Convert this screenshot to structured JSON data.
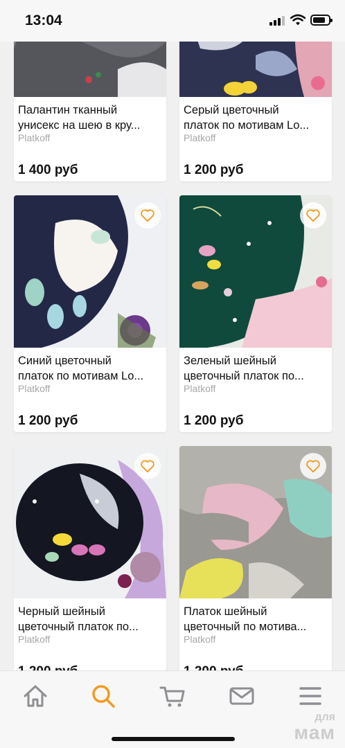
{
  "status_bar": {
    "time": "13:04"
  },
  "products": [
    {
      "title": "Палантин тканный\nунисекс  на шею в кру...",
      "shop": "Platkoff",
      "price": "1 400 руб"
    },
    {
      "title": "Серый   цветочный\nплаток  по мотивам Lo...",
      "shop": "Platkoff",
      "price": "1 200 руб"
    },
    {
      "title": "Синий  цветочный\nплаток  по мотивам Lo...",
      "shop": "Platkoff",
      "price": "1 200 руб"
    },
    {
      "title": "Зеленый шейный\nцветочный платок  по...",
      "shop": "Platkoff",
      "price": "1 200 руб"
    },
    {
      "title": "Черный шейный\nцветочный платок  по...",
      "shop": "Platkoff",
      "price": "1 200 руб"
    },
    {
      "title": "Платок шейный\nцветочный   по мотива...",
      "shop": "Platkoff",
      "price": "1 200 руб"
    }
  ],
  "tab_bar": {
    "icons": [
      "home-icon",
      "search-icon",
      "cart-icon",
      "mail-icon",
      "menu-icon"
    ],
    "active": "search-icon"
  },
  "watermark": {
    "line1": "для",
    "line2": "мам"
  },
  "colors": {
    "accent": "#f39a1e",
    "price": "#111111",
    "shop": "#a7a7a7",
    "tab_icon": "#8e8e93"
  }
}
